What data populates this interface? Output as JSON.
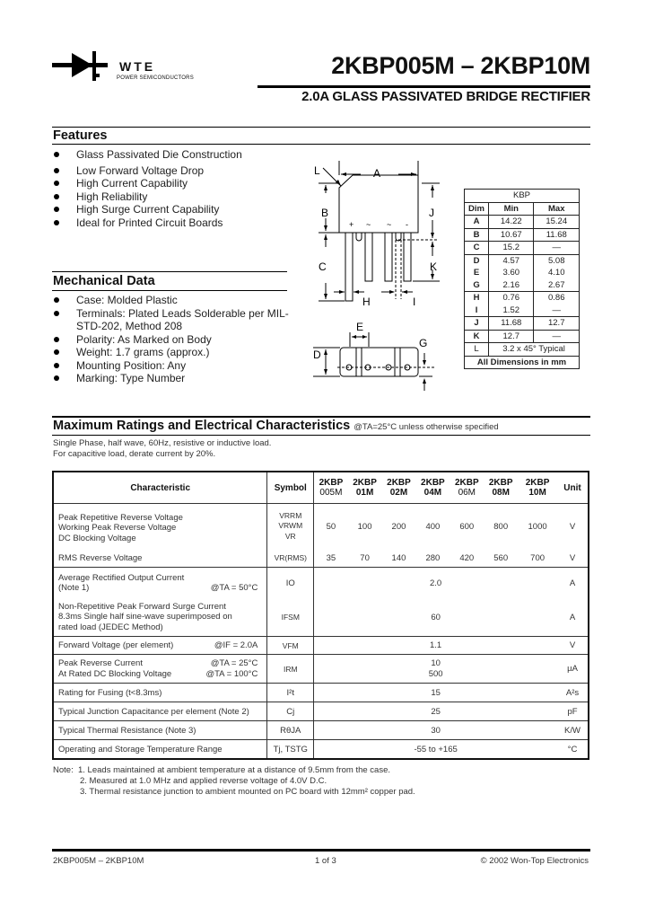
{
  "header": {
    "logo_brand": "WTE",
    "logo_tagline": "POWER SEMICONDUCTORS",
    "title": "2KBP005M – 2KBP10M",
    "subtitle": "2.0A GLASS PASSIVATED BRIDGE RECTIFIER"
  },
  "features": {
    "heading": "Features",
    "items": [
      "Glass Passivated Die Construction",
      "Low Forward Voltage Drop",
      "High Current Capability",
      "High Reliability",
      "High Surge Current Capability",
      "Ideal for Printed Circuit Boards"
    ]
  },
  "mechanical": {
    "heading": "Mechanical Data",
    "items": [
      "Case: Molded Plastic",
      "Terminals: Plated Leads Solderable per MIL-STD-202, Method 208",
      "Polarity: As Marked on Body",
      "Weight: 1.7 grams (approx.)",
      "Mounting Position: Any",
      "Marking: Type Number"
    ]
  },
  "diagram": {
    "labels": [
      "L",
      "A",
      "B",
      "J",
      "C",
      "K",
      "H",
      "I",
      "E",
      "D",
      "G"
    ],
    "pin_marks": [
      "+",
      "~",
      "~",
      "-"
    ]
  },
  "dim_table": {
    "package": "KBP",
    "headers": [
      "Dim",
      "Min",
      "Max"
    ],
    "rows": [
      [
        "A",
        "14.22",
        "15.24"
      ],
      [
        "B",
        "10.67",
        "11.68"
      ],
      [
        "C",
        "15.2",
        "—"
      ],
      [
        "D",
        "4.57",
        "5.08"
      ],
      [
        "E",
        "3.60",
        "4.10"
      ],
      [
        "G",
        "2.16",
        "2.67"
      ],
      [
        "H",
        "0.76",
        "0.86"
      ],
      [
        "I",
        "1.52",
        "—"
      ],
      [
        "J",
        "11.68",
        "12.7"
      ],
      [
        "K",
        "12.7",
        "—"
      ]
    ],
    "row_L": [
      "L",
      "3.2 x 45° Typical"
    ],
    "footer": "All Dimensions in mm"
  },
  "ratings": {
    "heading": "Maximum Ratings and Electrical Characteristics",
    "condition": "@TA=25°C unless otherwise specified",
    "note1": "Single Phase, half wave, 60Hz, resistive or inductive load.",
    "note2": "For capacitive load, derate current by 20%.",
    "columns": {
      "characteristic": "Characteristic",
      "symbol": "Symbol",
      "parts": [
        [
          "2KBP",
          "005M"
        ],
        [
          "2KBP",
          "01M"
        ],
        [
          "2KBP",
          "02M"
        ],
        [
          "2KBP",
          "04M"
        ],
        [
          "2KBP",
          "06M"
        ],
        [
          "2KBP",
          "08M"
        ],
        [
          "2KBP",
          "10M"
        ]
      ],
      "unit": "Unit"
    },
    "rows": {
      "voltage": {
        "chars": [
          "Peak Repetitive Reverse Voltage",
          "Working Peak Reverse Voltage",
          "DC Blocking Voltage"
        ],
        "symbols": [
          "VRRM",
          "VRWM",
          "VR"
        ],
        "values": [
          "50",
          "100",
          "200",
          "400",
          "600",
          "800",
          "1000"
        ],
        "unit": "V"
      },
      "rms": {
        "char": "RMS Reverse Voltage",
        "symbol": "VR(RMS)",
        "values": [
          "35",
          "70",
          "140",
          "280",
          "420",
          "560",
          "700"
        ],
        "unit": "V"
      },
      "io": {
        "char1": "Average Rectified Output Current",
        "char2": "(Note 1)",
        "cond": "@TA = 50°C",
        "symbol": "IO",
        "value": "2.0",
        "unit": "A"
      },
      "ifsm": {
        "chars": [
          "Non-Repetitive Peak Forward Surge Current",
          "8.3ms Single half sine-wave superimposed on",
          "rated load (JEDEC Method)"
        ],
        "symbol": "IFSM",
        "value": "60",
        "unit": "A"
      },
      "vfm": {
        "char": "Forward Voltage (per element)",
        "cond": "@IF = 2.0A",
        "symbol": "VFM",
        "value": "1.1",
        "unit": "V"
      },
      "irm": {
        "char1": "Peak Reverse Current",
        "cond1": "@TA = 25°C",
        "char2": "At Rated DC Blocking Voltage",
        "cond2": "@TA = 100°C",
        "symbol": "IRM",
        "value1": "10",
        "value2": "500",
        "unit": "µA"
      },
      "i2t": {
        "char": "Rating for Fusing (t<8.3ms)",
        "symbol": "I²t",
        "value": "15",
        "unit": "A²s"
      },
      "cj": {
        "char": "Typical Junction Capacitance per element (Note 2)",
        "symbol": "Cj",
        "value": "25",
        "unit": "pF"
      },
      "rth": {
        "char": "Typical Thermal Resistance (Note 3)",
        "symbol": "RθJA",
        "value": "30",
        "unit": "K/W"
      },
      "temp": {
        "char": "Operating and Storage Temperature Range",
        "symbol": "Tj, TSTG",
        "value": "-55 to +165",
        "unit": "°C"
      }
    }
  },
  "notes": {
    "label": "Note:",
    "items": [
      "1. Leads maintained at ambient temperature at a distance of 9.5mm from the case.",
      "2. Measured at 1.0 MHz and applied reverse voltage of 4.0V D.C.",
      "3. Thermal resistance junction to ambient mounted on PC board with 12mm² copper pad."
    ]
  },
  "footer": {
    "left": "2KBP005M – 2KBP10M",
    "center": "1 of 3",
    "right": "© 2002 Won-Top Electronics"
  }
}
